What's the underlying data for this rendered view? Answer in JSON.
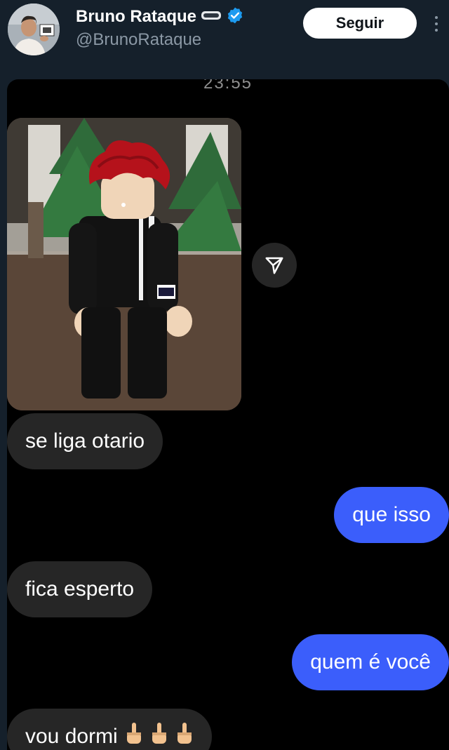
{
  "header": {
    "display_name": "Bruno Rataque",
    "handle": "@BrunoRataque",
    "follow_label": "Seguir",
    "verified_color": "#1d9bf0"
  },
  "chat": {
    "timestamp": "23:55",
    "messages": [
      {
        "direction": "incoming",
        "text": "se liga otario"
      },
      {
        "direction": "outgoing",
        "text": "que isso"
      },
      {
        "direction": "incoming",
        "text": "fica esperto"
      },
      {
        "direction": "outgoing",
        "text": "quem é você"
      },
      {
        "direction": "incoming",
        "text": "vou dormi",
        "emoji_count": 3
      }
    ]
  },
  "colors": {
    "background": "#15202b",
    "chat_background": "#000000",
    "incoming_bubble": "#262626",
    "outgoing_bubble": "#3b5efb"
  }
}
